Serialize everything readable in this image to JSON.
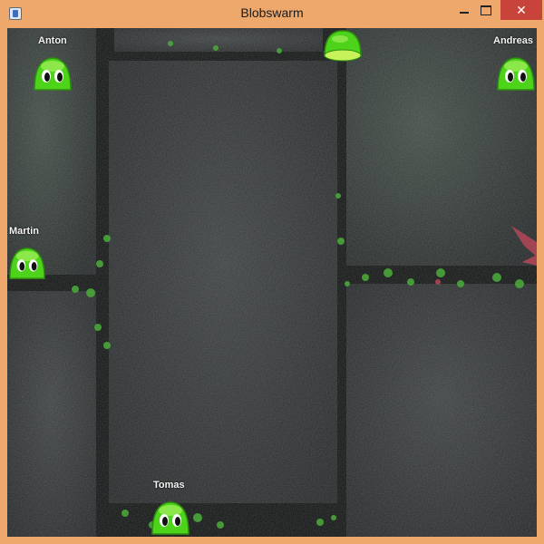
{
  "window": {
    "title": "Blobswarm",
    "controls": {
      "minimize": "minimize",
      "maximize": "maximize",
      "close": "✕"
    }
  },
  "game": {
    "blobs": [
      {
        "name": "Anton"
      },
      {
        "name": "Andreas"
      },
      {
        "name": "Martin"
      },
      {
        "name": "Tomas"
      },
      {
        "name": ""
      }
    ],
    "colors": {
      "blob_green": "#4cd31a",
      "blob_highlight": "#b8f56a",
      "ground_dark": "#1e2024",
      "ground_light": "#3b4340",
      "plant_green": "#4aa63a"
    }
  }
}
